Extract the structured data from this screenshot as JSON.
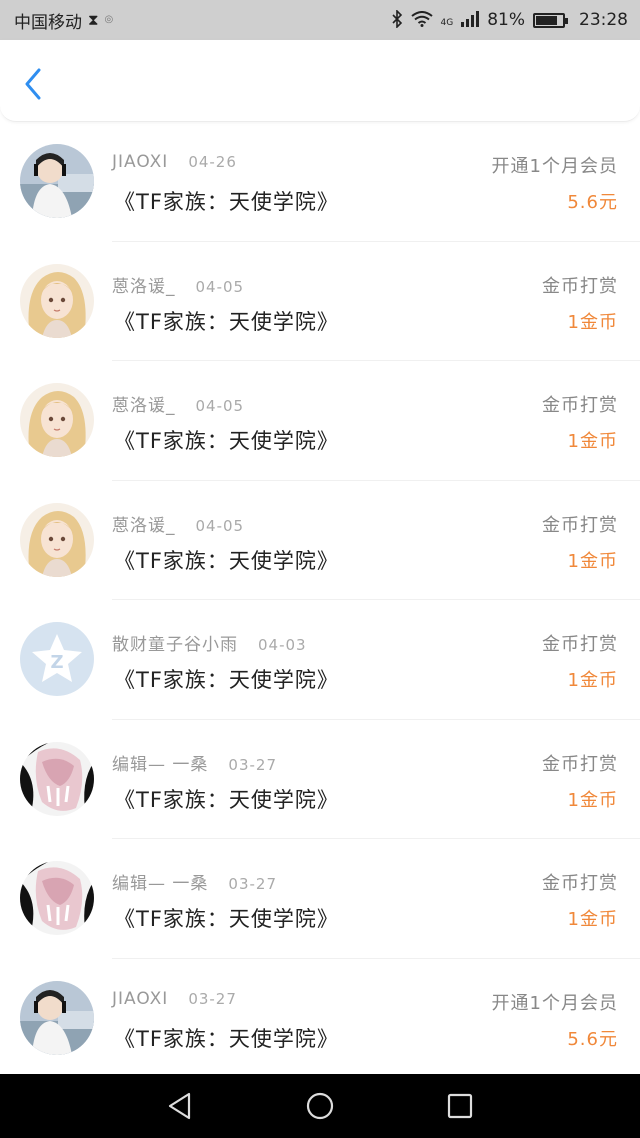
{
  "status_bar": {
    "carrier": "中国移动",
    "network": "4G",
    "battery": "81%",
    "battery_level": 0.81,
    "time": "23:28"
  },
  "colors": {
    "accent_blue": "#2f8ef0",
    "amount_orange": "#f0883a"
  },
  "records": [
    {
      "user": "JIAOXI",
      "date": "04-26",
      "book": "《TF家族：天使学院》",
      "type": "开通1个月会员",
      "amount": "5.6元",
      "avatar": "avatar-photo-girl"
    },
    {
      "user": "蒽洛谖_",
      "date": "04-05",
      "book": "《TF家族：天使学院》",
      "type": "金币打赏",
      "amount": "1金币",
      "avatar": "avatar-anime-blonde"
    },
    {
      "user": "蒽洛谖_",
      "date": "04-05",
      "book": "《TF家族：天使学院》",
      "type": "金币打赏",
      "amount": "1金币",
      "avatar": "avatar-anime-blonde"
    },
    {
      "user": "蒽洛谖_",
      "date": "04-05",
      "book": "《TF家族：天使学院》",
      "type": "金币打赏",
      "amount": "1金币",
      "avatar": "avatar-anime-blonde"
    },
    {
      "user": "散财童子谷小雨",
      "date": "04-03",
      "book": "《TF家族：天使学院》",
      "type": "金币打赏",
      "amount": "1金币",
      "avatar": "avatar-default-star"
    },
    {
      "user": "编辑— 一桑",
      "date": "03-27",
      "book": "《TF家族：天使学院》",
      "type": "金币打赏",
      "amount": "1金币",
      "avatar": "avatar-pink-cat"
    },
    {
      "user": "编辑— 一桑",
      "date": "03-27",
      "book": "《TF家族：天使学院》",
      "type": "金币打赏",
      "amount": "1金币",
      "avatar": "avatar-pink-cat"
    },
    {
      "user": "JIAOXI",
      "date": "03-27",
      "book": "《TF家族：天使学院》",
      "type": "开通1个月会员",
      "amount": "5.6元",
      "avatar": "avatar-photo-girl"
    }
  ]
}
